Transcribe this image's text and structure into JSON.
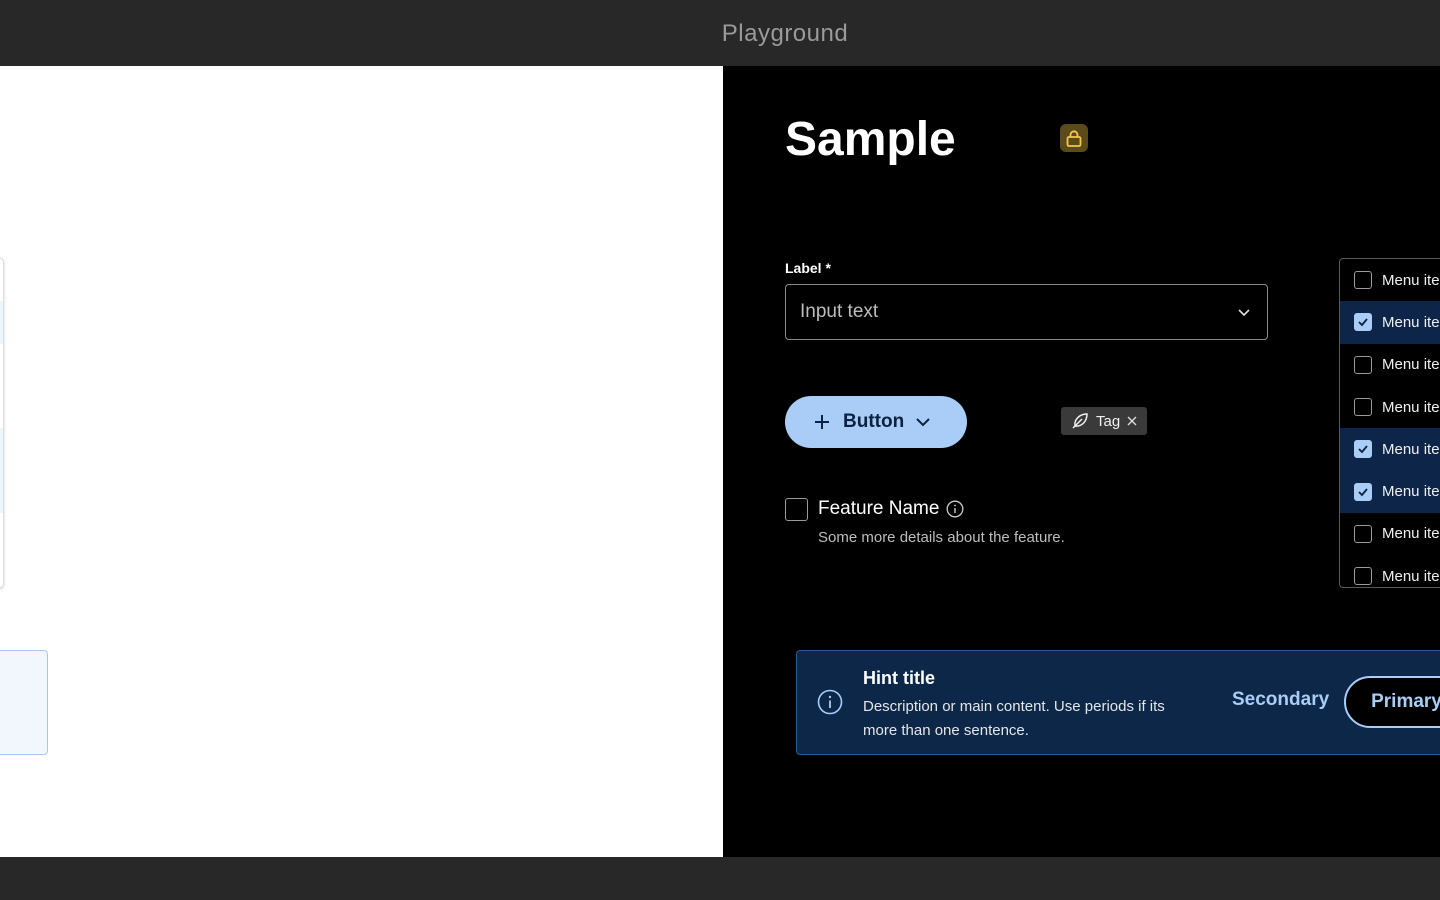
{
  "window": {
    "title": "Playground"
  },
  "sample": {
    "title": "Sample",
    "field_label": "Label *",
    "select_value": "Input text",
    "button_label": "Button",
    "tag_label": "Tag",
    "feature_name": "Feature Name",
    "feature_description": "Some more details about the feature.",
    "menu_items": [
      {
        "label": "Menu item",
        "checked": false
      },
      {
        "label": "Menu item",
        "checked": true
      },
      {
        "label": "Menu item",
        "checked": false
      },
      {
        "label": "Menu item",
        "checked": false
      },
      {
        "label": "Menu item",
        "checked": true
      },
      {
        "label": "Menu item",
        "checked": true
      },
      {
        "label": "Menu item",
        "checked": false
      },
      {
        "label": "Menu item",
        "checked": false
      }
    ],
    "hint": {
      "title": "Hint title",
      "description": "Description or main content. Use periods if its more than one sentence.",
      "secondary_label": "Secondary",
      "primary_label": "Primary"
    }
  },
  "icons": {
    "lock": "lock-icon",
    "chevron": "chevron-down-icon",
    "plus": "plus-icon",
    "tag": "feather-icon",
    "close": "close-icon",
    "info": "info-icon",
    "check": "check-icon"
  },
  "colors": {
    "light_accent": "#1565d8",
    "dark_accent": "#a9cdf7",
    "lock_light_bg": "#fde9a6",
    "lock_dark_bg": "#5b4a1a"
  }
}
